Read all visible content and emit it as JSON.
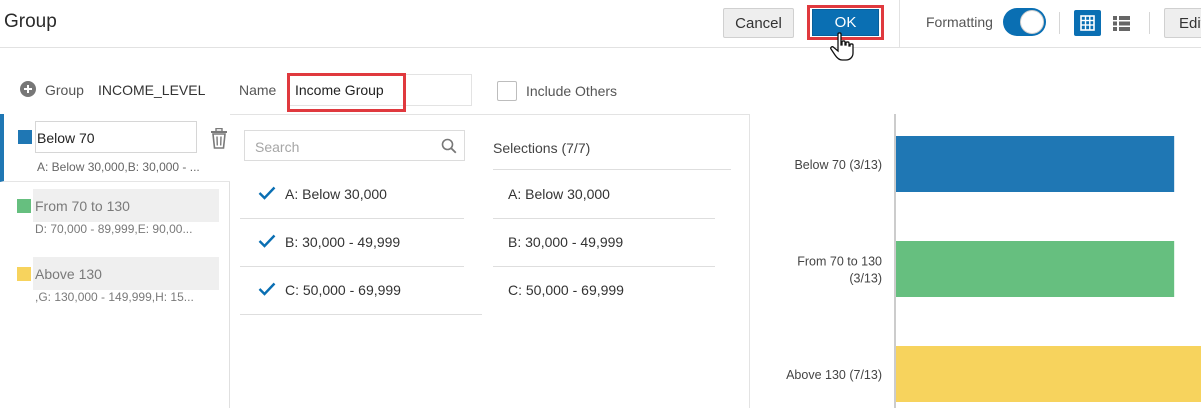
{
  "header": {
    "title": "Group",
    "cancel_label": "Cancel",
    "ok_label": "OK",
    "formatting_label": "Formatting",
    "formatting_on": true,
    "edit_label": "Edit",
    "accent_color": "#0a6fb3",
    "highlight_color": "#e0393e"
  },
  "group_bar": {
    "add_icon": "plus-circle-icon",
    "group_label": "Group",
    "group_column": "INCOME_LEVEL",
    "name_label": "Name",
    "name_value": "Income Group",
    "include_others_label": "Include Others",
    "include_others_checked": false
  },
  "groups": [
    {
      "name": "Below 70",
      "desc": "A: Below 30,000,B: 30,000 - ...",
      "color": "#1f77b4",
      "active": true
    },
    {
      "name": "From 70 to 130",
      "desc": "D: 70,000 - 89,999,E: 90,00...",
      "color": "#66bf7f",
      "active": false
    },
    {
      "name": "Above 130",
      "desc": ",G: 130,000 - 149,999,H: 15...",
      "color": "#f7d35d",
      "active": false
    }
  ],
  "search": {
    "placeholder": "Search"
  },
  "available_items": [
    {
      "label": "A: Below 30,000",
      "checked": true
    },
    {
      "label": "B: 30,000 - 49,999",
      "checked": true
    },
    {
      "label": "C: 50,000 - 69,999",
      "checked": true
    }
  ],
  "selections": {
    "title": "Selections (7/7)",
    "items": [
      "A: Below 30,000",
      "B: 30,000 - 49,999",
      "C: 50,000 - 69,999"
    ]
  },
  "chart_data": {
    "type": "bar",
    "orientation": "horizontal",
    "categories": [
      "Below 70 (3/13)",
      "From 70 to 130 (3/13)",
      "Above 130 (7/13)"
    ],
    "category_lines": [
      [
        "Below 70 (3/13)"
      ],
      [
        "From 70 to 130",
        "(3/13)"
      ],
      [
        "Above 130 (7/13)"
      ]
    ],
    "values": [
      3,
      3,
      7
    ],
    "colors": [
      "#1f77b4",
      "#66bf7f",
      "#f7d35d"
    ],
    "xlim": [
      0,
      3.3
    ],
    "grid": false
  }
}
